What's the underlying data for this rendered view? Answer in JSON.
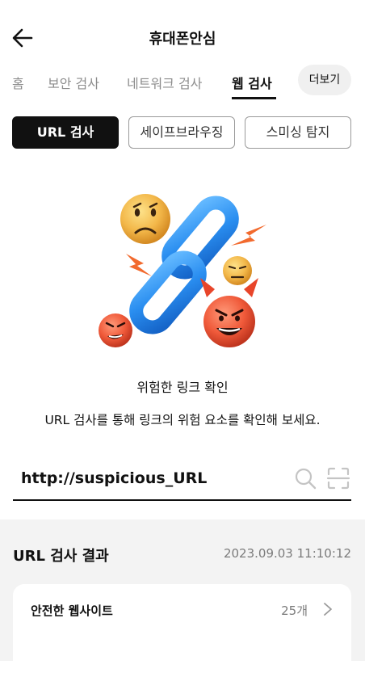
{
  "header": {
    "title": "휴대폰안심"
  },
  "tabs": [
    {
      "label": "홈"
    },
    {
      "label": "보안 검사"
    },
    {
      "label": "네트워크 검사"
    },
    {
      "label": "웹 검사"
    }
  ],
  "more_label": "더보기",
  "subtabs": [
    {
      "label": "URL 검사"
    },
    {
      "label": "세이프브라우징"
    },
    {
      "label": "스미싱 탐지"
    }
  ],
  "hero": {
    "headline": "위험한 링크 확인",
    "description": "URL 검사를 통해 링크의 위험 요소를 확인해 보세요."
  },
  "url_input": {
    "value": "http://suspicious_URL"
  },
  "results": {
    "title": "URL 검사 결과",
    "timestamp": "2023.09.03 11:10:12",
    "items": [
      {
        "label": "안전한 웹사이트",
        "count": "25개"
      }
    ]
  },
  "colors": {
    "primary": "#111111",
    "muted": "#8c8c8c",
    "section_bg": "#f3f3f3"
  }
}
